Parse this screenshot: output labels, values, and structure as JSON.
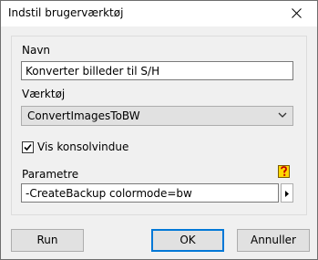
{
  "window": {
    "title": "Indstil brugerværktøj"
  },
  "form": {
    "name_label": "Navn",
    "name_value": "Konverter billeder til S/H",
    "tool_label": "Værktøj",
    "tool_value": "ConvertImagesToBW",
    "console_checkbox_label": "Vis konsolvindue",
    "console_checkbox_checked": true,
    "params_label": "Parametre",
    "params_value": "-CreateBackup colormode=bw"
  },
  "buttons": {
    "run": "Run",
    "ok": "OK",
    "cancel": "Annuller"
  },
  "icons": {
    "close": "close-icon",
    "help": "help-icon",
    "combo_arrow": "chevron-down-icon",
    "params_menu": "chevron-right-icon",
    "check": "checkmark-icon"
  },
  "colors": {
    "default_button_border": "#0078d7",
    "help_icon_yellow": "#ffd800",
    "help_icon_red": "#c00000"
  }
}
